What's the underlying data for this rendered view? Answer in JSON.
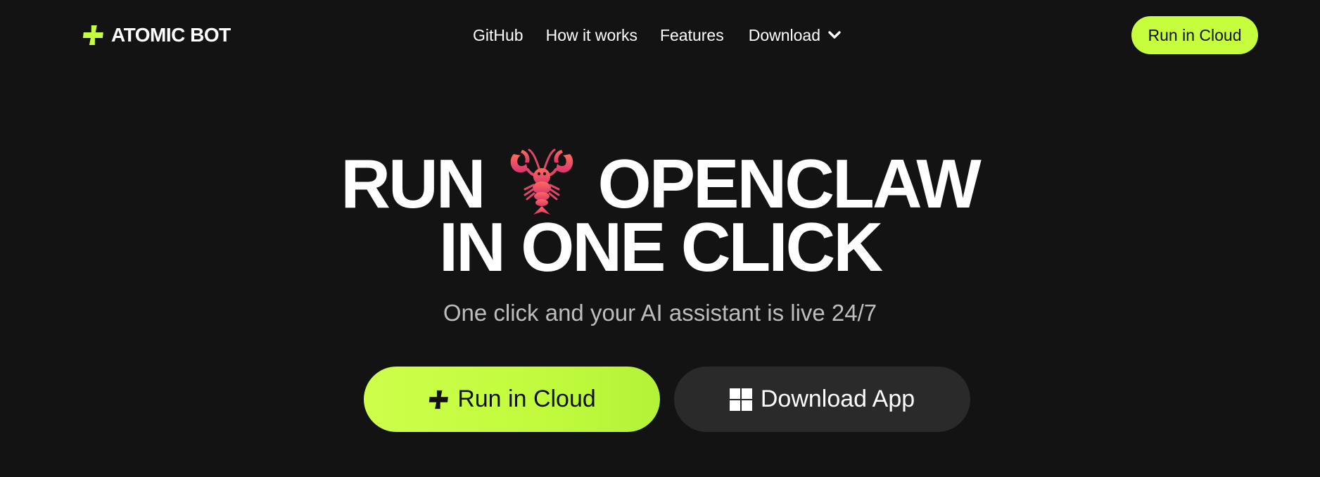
{
  "nav": {
    "logo_text": "ATOMIC BOT",
    "links": [
      "GitHub",
      "How it works",
      "Features",
      "Download"
    ],
    "cta_label": "Run in Cloud"
  },
  "hero": {
    "line1_left": "RUN",
    "line1_right": "OPENCLAW",
    "line2": "IN ONE CLICK",
    "subtitle": "One click and your AI assistant is live 24/7",
    "primary_button": "Run in Cloud",
    "secondary_button": "Download App"
  },
  "colors": {
    "background": "#131313",
    "accent": "#c6fe3e",
    "secondary_button_bg": "#2a2a2a",
    "subtitle_text": "#bdbdbd"
  },
  "icons": [
    "plus-logo-icon",
    "chevron-down-icon",
    "lobster-icon",
    "windows-icon"
  ]
}
